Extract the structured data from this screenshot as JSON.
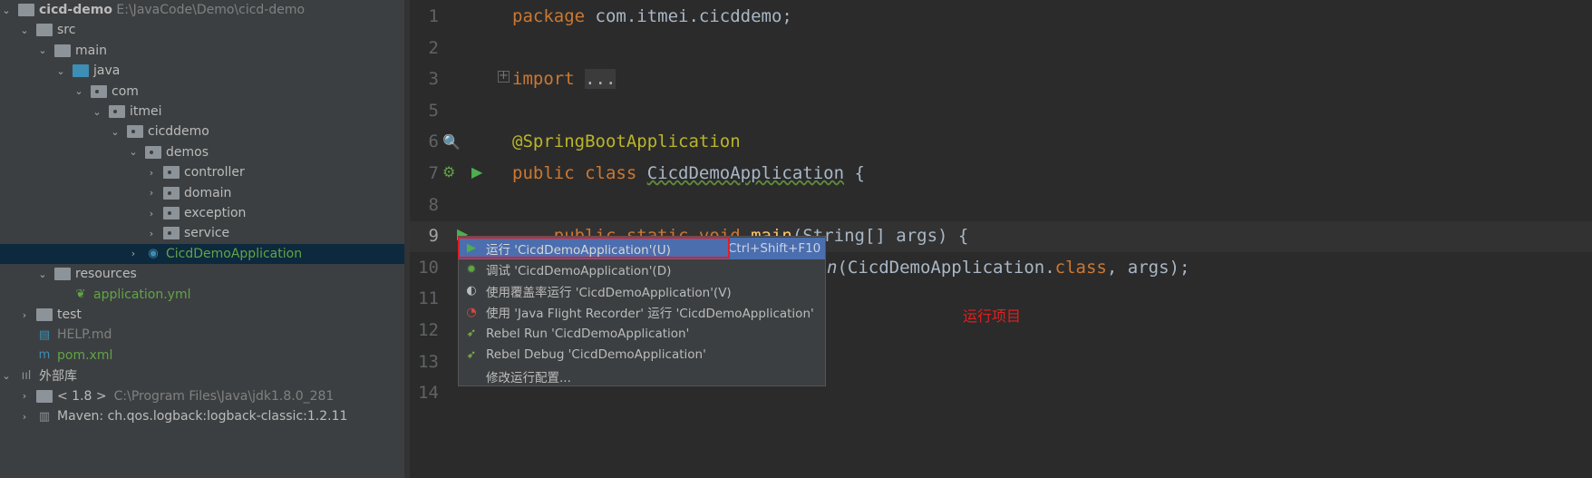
{
  "project_tree": {
    "root": {
      "name": "cicd-demo",
      "path": "E:\\JavaCode\\Demo\\cicd-demo"
    },
    "items": [
      {
        "label": "src",
        "depth": 1,
        "chevron": "down",
        "icon": "folder-icon"
      },
      {
        "label": "main",
        "depth": 2,
        "chevron": "down",
        "icon": "folder-icon"
      },
      {
        "label": "java",
        "depth": 3,
        "chevron": "down",
        "icon": "source-folder-icon"
      },
      {
        "label": "com",
        "depth": 4,
        "chevron": "down",
        "icon": "package-icon"
      },
      {
        "label": "itmei",
        "depth": 5,
        "chevron": "down",
        "icon": "package-icon"
      },
      {
        "label": "cicddemo",
        "depth": 6,
        "chevron": "down",
        "icon": "package-icon"
      },
      {
        "label": "demos",
        "depth": 7,
        "chevron": "down",
        "icon": "package-icon"
      },
      {
        "label": "controller",
        "depth": 8,
        "chevron": "right",
        "icon": "package-icon"
      },
      {
        "label": "domain",
        "depth": 8,
        "chevron": "right",
        "icon": "package-icon"
      },
      {
        "label": "exception",
        "depth": 8,
        "chevron": "right",
        "icon": "package-icon"
      },
      {
        "label": "service",
        "depth": 8,
        "chevron": "right",
        "icon": "package-icon"
      },
      {
        "label": "CicdDemoApplication",
        "depth": 7,
        "chevron": "right",
        "icon": "spring-boot-class-icon",
        "selected": true
      },
      {
        "label": "resources",
        "depth": 2,
        "chevron": "down",
        "icon": "resources-folder-icon"
      },
      {
        "label": "application.yml",
        "depth": 3,
        "chevron": "",
        "icon": "spring-config-icon"
      },
      {
        "label": "test",
        "depth": 1,
        "chevron": "right",
        "icon": "folder-icon"
      },
      {
        "label": "HELP.md",
        "depth": 1,
        "chevron": "",
        "icon": "markdown-icon"
      },
      {
        "label": "pom.xml",
        "depth": 1,
        "chevron": "",
        "icon": "maven-icon"
      },
      {
        "label": "外部库",
        "depth": 0,
        "chevron": "down",
        "icon": "libraries-icon"
      },
      {
        "label": "< 1.8 >",
        "suffix": "C:\\Program Files\\Java\\jdk1.8.0_281",
        "depth": 1,
        "chevron": "right",
        "icon": "jdk-folder-icon"
      },
      {
        "label": "Maven: ch.qos.logback:logback-classic:1.2.11",
        "depth": 1,
        "chevron": "right",
        "icon": "library-icon"
      }
    ]
  },
  "editor": {
    "line_numbers": [
      "1",
      "2",
      "3",
      "5",
      "6",
      "7",
      "8",
      "9",
      "10",
      "11",
      "12",
      "13",
      "14"
    ],
    "current_line": "9",
    "lines": {
      "l1a": "package ",
      "l1b": "com.itmei.cicddemo;",
      "l3a": "import ",
      "l3b": "...",
      "l6": "@SpringBootApplication",
      "l7a": "public class ",
      "l7b": "CicdDemoApplication",
      " l7c": " {",
      "l9a": "    public static void ",
      "l9b": "main",
      "l9c": "(String[] args) {",
      "l10a": "n",
      "l10b": "(CicdDemoApplication.",
      "l10c": "class",
      ", l10d": ", args);"
    }
  },
  "context_menu": {
    "items": [
      {
        "label": "运行 'CicdDemoApplication'(U)",
        "shortcut": "Ctrl+Shift+F10",
        "icon": "run-icon",
        "selected": true
      },
      {
        "label": "调试 'CicdDemoApplication'(D)",
        "icon": "debug-icon"
      },
      {
        "label": "使用覆盖率运行  'CicdDemoApplication'(V)",
        "icon": "coverage-icon"
      },
      {
        "label": "使用 'Java Flight Recorder' 运行  'CicdDemoApplication'",
        "icon": "profiler-icon"
      },
      {
        "label": "Rebel Run 'CicdDemoApplication'",
        "icon": "jrebel-run-icon"
      },
      {
        "label": "Rebel Debug 'CicdDemoApplication'",
        "icon": "jrebel-debug-icon"
      },
      {
        "label": "修改运行配置...",
        "icon": ""
      }
    ]
  },
  "annotation": {
    "text": "运行项目",
    "color": "#e02020"
  },
  "colors": {
    "selection": "#4b6eaf",
    "highlight_box": "#e51c23",
    "keyword": "#cc7832",
    "annotation": "#bbb529"
  }
}
